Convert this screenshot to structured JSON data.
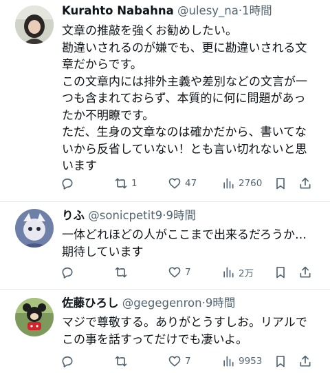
{
  "tweets": [
    {
      "author": {
        "name": "Kurahto Nabahna",
        "handle": "@ulesy_na",
        "separator": "·",
        "time": "1時間"
      },
      "lines": [
        "文章の推敲を強くお勧めしたい。",
        "勘違いされるのが嫌でも、更に勘違いされる文",
        "章だからです。",
        "この文章内には排外主義や差別などの文言が一",
        "つも含まれておらず、本質的に何に問題があっ",
        "たか不明瞭です。",
        "ただ、生身の文章なのは確かだから、書いてな",
        "いから反省していない！とも言い切れないと思",
        "います"
      ],
      "stats": {
        "replies": "",
        "retweets": "1",
        "likes": "47",
        "views": "2760"
      }
    },
    {
      "author": {
        "name": "りふ",
        "handle": "@sonicpetit9",
        "separator": "·",
        "time": "9時間"
      },
      "lines": [
        "一体どれほどの人がここまで出来るだろうか…",
        "期待しています"
      ],
      "stats": {
        "replies": "",
        "retweets": "",
        "likes": "7",
        "views": "2万"
      }
    },
    {
      "author": {
        "name": "佐藤ひろし",
        "handle": "@gegegenron",
        "separator": "·",
        "time": "9時間"
      },
      "lines": [
        "マジで尊敬する。ありがとうすしお。リアルで",
        "この事を話すってだけでも凄いよ。"
      ],
      "stats": {
        "replies": "",
        "retweets": "",
        "likes": "7",
        "views": "9953"
      }
    }
  ],
  "icons": {
    "reply": "reply-icon",
    "retweet": "retweet-icon",
    "like": "heart-icon",
    "views": "views-icon",
    "bookmark": "bookmark-icon",
    "share": "share-icon"
  },
  "colors": {
    "text": "#0f1419",
    "secondary": "#536471",
    "divider": "#e6e9ec"
  }
}
